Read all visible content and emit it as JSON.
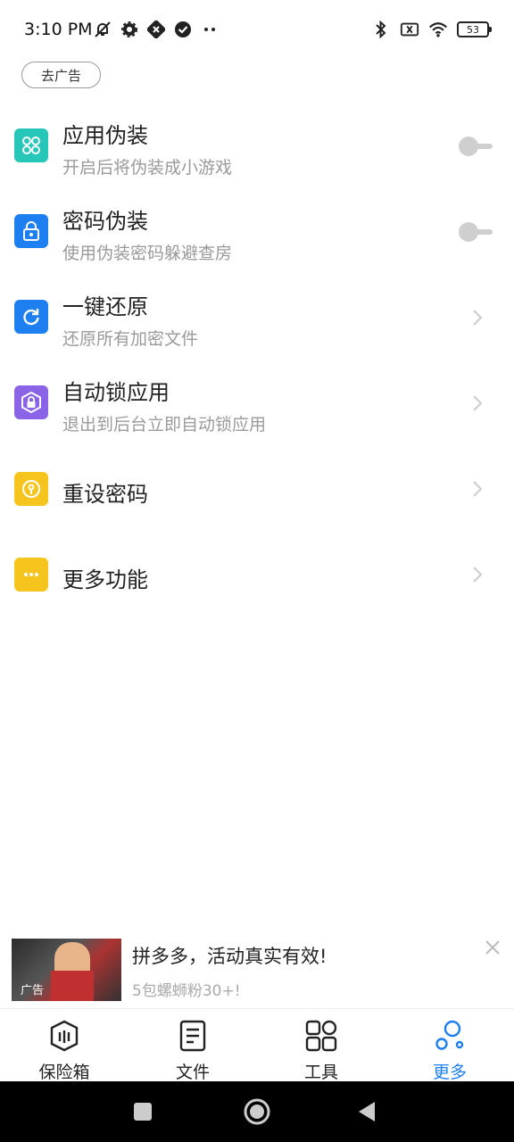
{
  "status_bar": {
    "time": "3:10 PM",
    "battery": "53",
    "left_icons": [
      "silent-icon",
      "gear-icon",
      "signal-x-icon",
      "check-circle-icon",
      "more-dots-icon"
    ],
    "right_icons": [
      "bluetooth-icon",
      "sim-x-icon",
      "wifi-icon",
      "battery-icon"
    ]
  },
  "ad_button": {
    "label": "去广告"
  },
  "menu": [
    {
      "title": "应用伪装",
      "subtitle": "开启后将伪装成小游戏",
      "icon": "grid-apps-icon",
      "icon_color": "#26c6b9",
      "control": "toggle"
    },
    {
      "title": "密码伪装",
      "subtitle": "使用伪装密码躲避查房",
      "icon": "lock-icon",
      "icon_color": "#1e7ff0",
      "control": "toggle"
    },
    {
      "title": "一键还原",
      "subtitle": "还原所有加密文件",
      "icon": "refresh-icon",
      "icon_color": "#1e7ff0",
      "control": "chevron"
    },
    {
      "title": "自动锁应用",
      "subtitle": "退出到后台立即自动锁应用",
      "icon": "hex-lock-icon",
      "icon_color": "#8b63e6",
      "control": "chevron"
    },
    {
      "title": "重设密码",
      "subtitle": "",
      "icon": "key-icon",
      "icon_color": "#f6c51d",
      "control": "chevron"
    },
    {
      "title": "更多功能",
      "subtitle": "",
      "icon": "dots-icon",
      "icon_color": "#f6c51d",
      "control": "chevron"
    }
  ],
  "ad_banner": {
    "title": "拼多多，活动真实有效!",
    "subtitle": "5包螺蛳粉30+!",
    "tag": "广告"
  },
  "bottom_nav": [
    {
      "label": "保险箱",
      "icon": "vault-icon",
      "active": false
    },
    {
      "label": "文件",
      "icon": "document-icon",
      "active": false
    },
    {
      "label": "工具",
      "icon": "tools-grid-icon",
      "active": false
    },
    {
      "label": "更多",
      "icon": "more-circles-icon",
      "active": true
    }
  ],
  "colors": {
    "accent": "#1e7ff0",
    "text": "#222222",
    "subtext": "#9a9a9a"
  }
}
